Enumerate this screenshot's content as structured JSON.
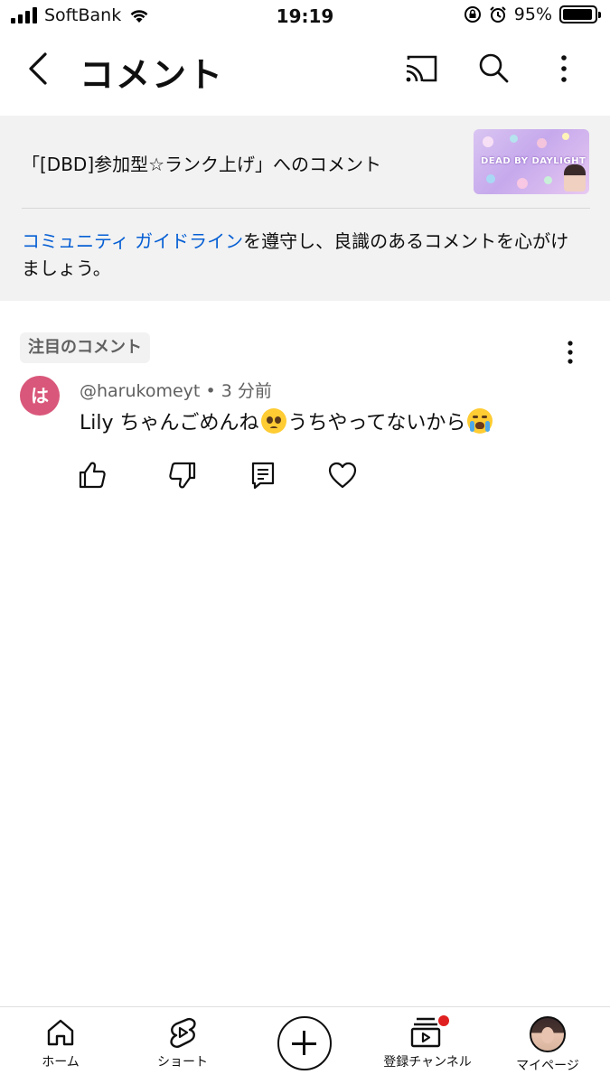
{
  "status_bar": {
    "carrier": "SoftBank",
    "time": "19:19",
    "battery_percent": "95%",
    "battery_level": 0.95
  },
  "header": {
    "title": "コメント",
    "icons": [
      "back-icon",
      "cast-icon",
      "search-icon",
      "more-vert-icon"
    ]
  },
  "info_panel": {
    "video_title": "「[DBD]参加型☆ランク上げ」へのコメント",
    "thumbnail_text": "DEAD BY DAYLIGHT",
    "guideline_link": "コミュニティ ガイドライン",
    "guideline_rest_1": "を遵守し、良識のあるコメントを心がけ",
    "guideline_rest_2": "ましょう。"
  },
  "comment": {
    "pinned_label": "注目のコメント",
    "avatar_letter": "は",
    "author": "@harukomeyt",
    "separator": "•",
    "time": "3 分前",
    "text_part1": "Lily ちゃんごめんね",
    "text_part2": "うちやってないから",
    "emoji_1": "pleading-face",
    "emoji_2": "loudly-crying-face",
    "colors": {
      "avatar_bg": "#d9577a",
      "link": "#065fd4"
    }
  },
  "bottom_nav": {
    "items": [
      {
        "label": "ホーム",
        "icon": "home-icon"
      },
      {
        "label": "ショート",
        "icon": "shorts-icon"
      },
      {
        "label": "",
        "icon": "create-icon"
      },
      {
        "label": "登録チャンネル",
        "icon": "subscriptions-icon"
      },
      {
        "label": "マイページ",
        "icon": "profile-avatar"
      }
    ],
    "notification_color": "#e02020"
  }
}
